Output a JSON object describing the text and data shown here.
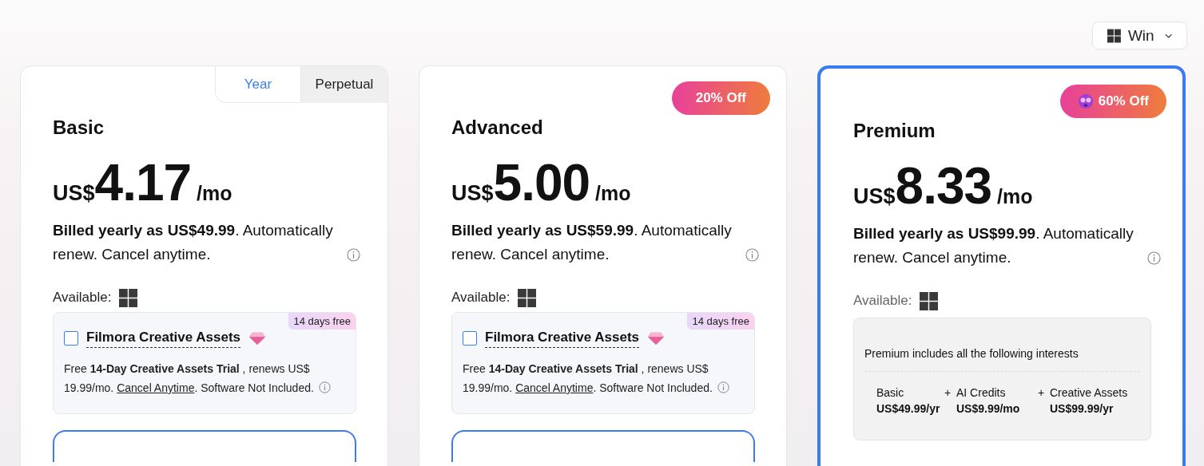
{
  "platform": {
    "label": "Win"
  },
  "cards": [
    {
      "kind": "addon",
      "selected": false,
      "tabs": [
        {
          "label": "Year",
          "selected": true
        },
        {
          "label": "Perpetual",
          "selected": false
        }
      ],
      "name": "Basic",
      "currency": "US$",
      "price": "4.17",
      "unit": "/mo",
      "billing": "**Billed yearly as US$49.99**. Automatically renew. Cancel anytime.",
      "available": "Available:",
      "addon": {
        "checked": false,
        "title": "Filmora Creative Assets",
        "tag": "14 days free",
        "desc_before": "Free **14-Day Creative Assets Trial** , renews US$ 19.99/mo. ",
        "link": "Cancel Anytime",
        "desc_after": ". Software Not Included."
      }
    },
    {
      "kind": "addon",
      "selected": false,
      "badge": {
        "kind": "plain",
        "text": "20% Off"
      },
      "name": "Advanced",
      "currency": "US$",
      "price": "5.00",
      "unit": "/mo",
      "billing": "**Billed yearly as US$59.99**. Automatically renew. Cancel anytime.",
      "available": "Available:",
      "addon": {
        "checked": false,
        "title": "Filmora Creative Assets",
        "tag": "14 days free",
        "desc_before": "Free **14-Day Creative Assets Trial** , renews US$ 19.99/mo. ",
        "link": "Cancel Anytime",
        "desc_after": ". Software Not Included."
      }
    },
    {
      "kind": "bundle",
      "selected": true,
      "badge": {
        "kind": "emoji",
        "text": "60% Off"
      },
      "name": "Premium",
      "currency": "US$",
      "price": "8.33",
      "unit": "/mo",
      "billing": "**Billed yearly as US$99.99**. Automatically renew. Cancel anytime.",
      "available": "Available:",
      "includes": {
        "heading": "Premium includes all the following interests",
        "items": [
          {
            "name": "Basic",
            "price": "US$49.99/yr"
          },
          {
            "plus": "+",
            "name": "AI Credits",
            "price": "US$9.99/mo"
          },
          {
            "plus": "+",
            "name": "Creative Assets",
            "price": "US$99.99/yr"
          }
        ]
      }
    }
  ]
}
